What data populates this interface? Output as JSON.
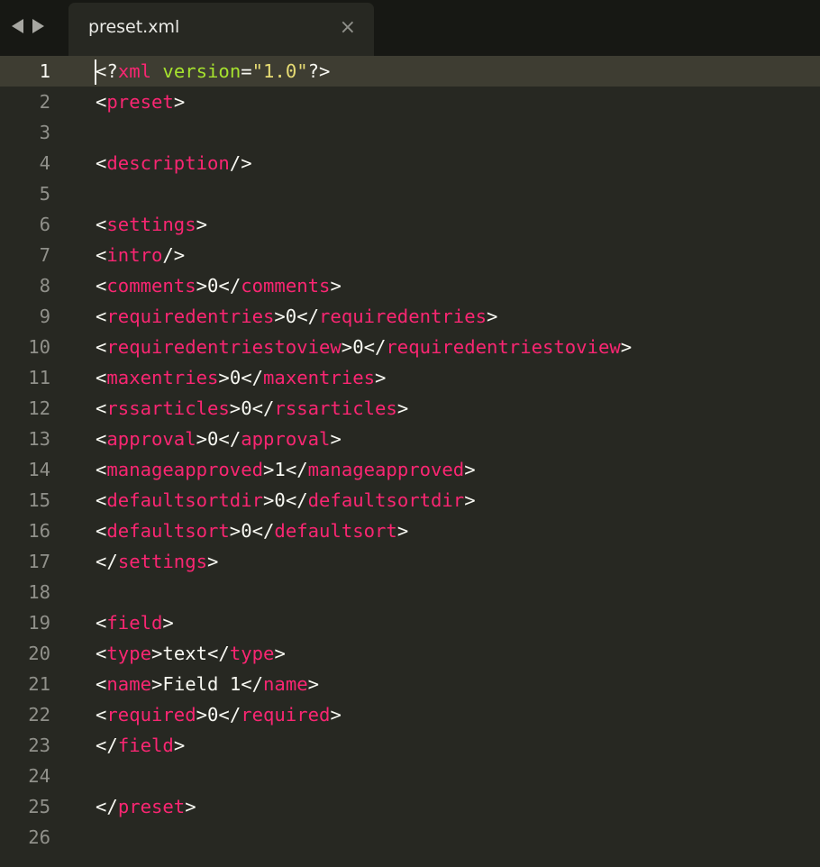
{
  "tab": {
    "title": "preset.xml",
    "close_glyph": "×"
  },
  "icons": [
    "back-arrow-icon",
    "forward-arrow-icon",
    "close-icon"
  ],
  "colors": {
    "background": "#272822",
    "tab_bar": "#171814",
    "current_line": "#3e3d32",
    "line_number": "#90908a",
    "tag": "#f92672",
    "attribute": "#a6e22e",
    "string": "#e6db74",
    "text": "#f8f8f2"
  },
  "editor": {
    "current_line": 1,
    "lines": [
      [
        [
          "p",
          "<?"
        ],
        [
          "tag",
          "xml"
        ],
        [
          "p",
          " "
        ],
        [
          "attr",
          "version"
        ],
        [
          "p",
          "="
        ],
        [
          "str",
          "\"1.0\""
        ],
        [
          "p",
          "?>"
        ]
      ],
      [
        [
          "p",
          "<"
        ],
        [
          "tag",
          "preset"
        ],
        [
          "p",
          ">"
        ]
      ],
      [],
      [
        [
          "p",
          "<"
        ],
        [
          "tag",
          "description"
        ],
        [
          "p",
          "/>"
        ]
      ],
      [],
      [
        [
          "p",
          "<"
        ],
        [
          "tag",
          "settings"
        ],
        [
          "p",
          ">"
        ]
      ],
      [
        [
          "p",
          "<"
        ],
        [
          "tag",
          "intro"
        ],
        [
          "p",
          "/>"
        ]
      ],
      [
        [
          "p",
          "<"
        ],
        [
          "tag",
          "comments"
        ],
        [
          "p",
          ">"
        ],
        [
          "text",
          "0"
        ],
        [
          "p",
          "</"
        ],
        [
          "tag",
          "comments"
        ],
        [
          "p",
          ">"
        ]
      ],
      [
        [
          "p",
          "<"
        ],
        [
          "tag",
          "requiredentries"
        ],
        [
          "p",
          ">"
        ],
        [
          "text",
          "0"
        ],
        [
          "p",
          "</"
        ],
        [
          "tag",
          "requiredentries"
        ],
        [
          "p",
          ">"
        ]
      ],
      [
        [
          "p",
          "<"
        ],
        [
          "tag",
          "requiredentriestoview"
        ],
        [
          "p",
          ">"
        ],
        [
          "text",
          "0"
        ],
        [
          "p",
          "</"
        ],
        [
          "tag",
          "requiredentriestoview"
        ],
        [
          "p",
          ">"
        ]
      ],
      [
        [
          "p",
          "<"
        ],
        [
          "tag",
          "maxentries"
        ],
        [
          "p",
          ">"
        ],
        [
          "text",
          "0"
        ],
        [
          "p",
          "</"
        ],
        [
          "tag",
          "maxentries"
        ],
        [
          "p",
          ">"
        ]
      ],
      [
        [
          "p",
          "<"
        ],
        [
          "tag",
          "rssarticles"
        ],
        [
          "p",
          ">"
        ],
        [
          "text",
          "0"
        ],
        [
          "p",
          "</"
        ],
        [
          "tag",
          "rssarticles"
        ],
        [
          "p",
          ">"
        ]
      ],
      [
        [
          "p",
          "<"
        ],
        [
          "tag",
          "approval"
        ],
        [
          "p",
          ">"
        ],
        [
          "text",
          "0"
        ],
        [
          "p",
          "</"
        ],
        [
          "tag",
          "approval"
        ],
        [
          "p",
          ">"
        ]
      ],
      [
        [
          "p",
          "<"
        ],
        [
          "tag",
          "manageapproved"
        ],
        [
          "p",
          ">"
        ],
        [
          "text",
          "1"
        ],
        [
          "p",
          "</"
        ],
        [
          "tag",
          "manageapproved"
        ],
        [
          "p",
          ">"
        ]
      ],
      [
        [
          "p",
          "<"
        ],
        [
          "tag",
          "defaultsortdir"
        ],
        [
          "p",
          ">"
        ],
        [
          "text",
          "0"
        ],
        [
          "p",
          "</"
        ],
        [
          "tag",
          "defaultsortdir"
        ],
        [
          "p",
          ">"
        ]
      ],
      [
        [
          "p",
          "<"
        ],
        [
          "tag",
          "defaultsort"
        ],
        [
          "p",
          ">"
        ],
        [
          "text",
          "0"
        ],
        [
          "p",
          "</"
        ],
        [
          "tag",
          "defaultsort"
        ],
        [
          "p",
          ">"
        ]
      ],
      [
        [
          "p",
          "</"
        ],
        [
          "tag",
          "settings"
        ],
        [
          "p",
          ">"
        ]
      ],
      [],
      [
        [
          "p",
          "<"
        ],
        [
          "tag",
          "field"
        ],
        [
          "p",
          ">"
        ]
      ],
      [
        [
          "p",
          "<"
        ],
        [
          "tag",
          "type"
        ],
        [
          "p",
          ">"
        ],
        [
          "text",
          "text"
        ],
        [
          "p",
          "</"
        ],
        [
          "tag",
          "type"
        ],
        [
          "p",
          ">"
        ]
      ],
      [
        [
          "p",
          "<"
        ],
        [
          "tag",
          "name"
        ],
        [
          "p",
          ">"
        ],
        [
          "text",
          "Field 1"
        ],
        [
          "p",
          "</"
        ],
        [
          "tag",
          "name"
        ],
        [
          "p",
          ">"
        ]
      ],
      [
        [
          "p",
          "<"
        ],
        [
          "tag",
          "required"
        ],
        [
          "p",
          ">"
        ],
        [
          "text",
          "0"
        ],
        [
          "p",
          "</"
        ],
        [
          "tag",
          "required"
        ],
        [
          "p",
          ">"
        ]
      ],
      [
        [
          "p",
          "</"
        ],
        [
          "tag",
          "field"
        ],
        [
          "p",
          ">"
        ]
      ],
      [],
      [
        [
          "p",
          "</"
        ],
        [
          "tag",
          "preset"
        ],
        [
          "p",
          ">"
        ]
      ],
      []
    ]
  }
}
